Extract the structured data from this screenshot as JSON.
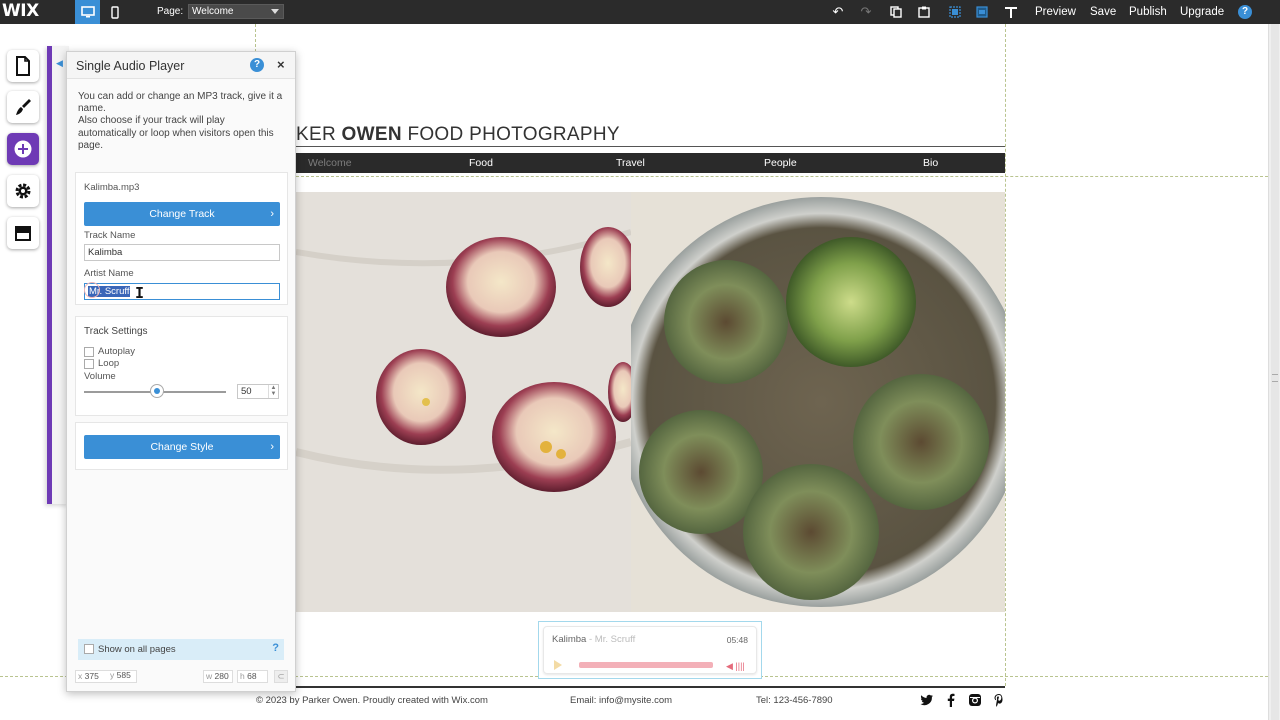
{
  "topbar": {
    "logo": "WIX",
    "page_label": "Page:",
    "page_select_value": "Welcome",
    "menu": {
      "preview": "Preview",
      "save": "Save",
      "publish": "Publish",
      "upgrade": "Upgrade"
    },
    "help": "?"
  },
  "panel": {
    "title": "Single Audio Player",
    "help": "?",
    "close": "×",
    "intro": "You can add or change an MP3 track, give it a name.\nAlso choose if your track will play automatically or loop when visitors open this page.",
    "file_name": "Kalimba.mp3",
    "change_track": "Change Track",
    "track_name_label": "Track Name",
    "track_name_value": "Kalimba",
    "artist_name_label": "Artist Name",
    "artist_name_value": "Mr. Scruff",
    "track_settings_label": "Track Settings",
    "autoplay_label": "Autoplay",
    "loop_label": "Loop",
    "volume_label": "Volume",
    "volume_value": "50",
    "change_style": "Change Style",
    "show_on_all_pages": "Show on all pages",
    "show_help": "?",
    "coords": {
      "x_label": "x",
      "x": "375",
      "y_label": "y",
      "y": "585",
      "w_label": "w",
      "w": "280",
      "h_label": "h",
      "h": "68"
    }
  },
  "site": {
    "title_pre": "KER ",
    "title_bold": "OWEN",
    "title_post": " FOOD PHOTOGRAPHY",
    "nav": [
      "Welcome",
      "Food",
      "Travel",
      "People",
      "Bio"
    ],
    "player": {
      "track": "Kalimba",
      "separator": " - ",
      "artist": "Mr. Scruff",
      "time": "05:48"
    },
    "footer": {
      "copyright": "© 2023 by Parker Owen. Proudly created with Wix.com",
      "email": "Email: info@mysite.com",
      "tel": "Tel: 123-456-7890"
    }
  },
  "colors": {
    "accent": "#3a8fd6",
    "purple": "#6e3ab5",
    "topbar": "#2b2b2b"
  }
}
